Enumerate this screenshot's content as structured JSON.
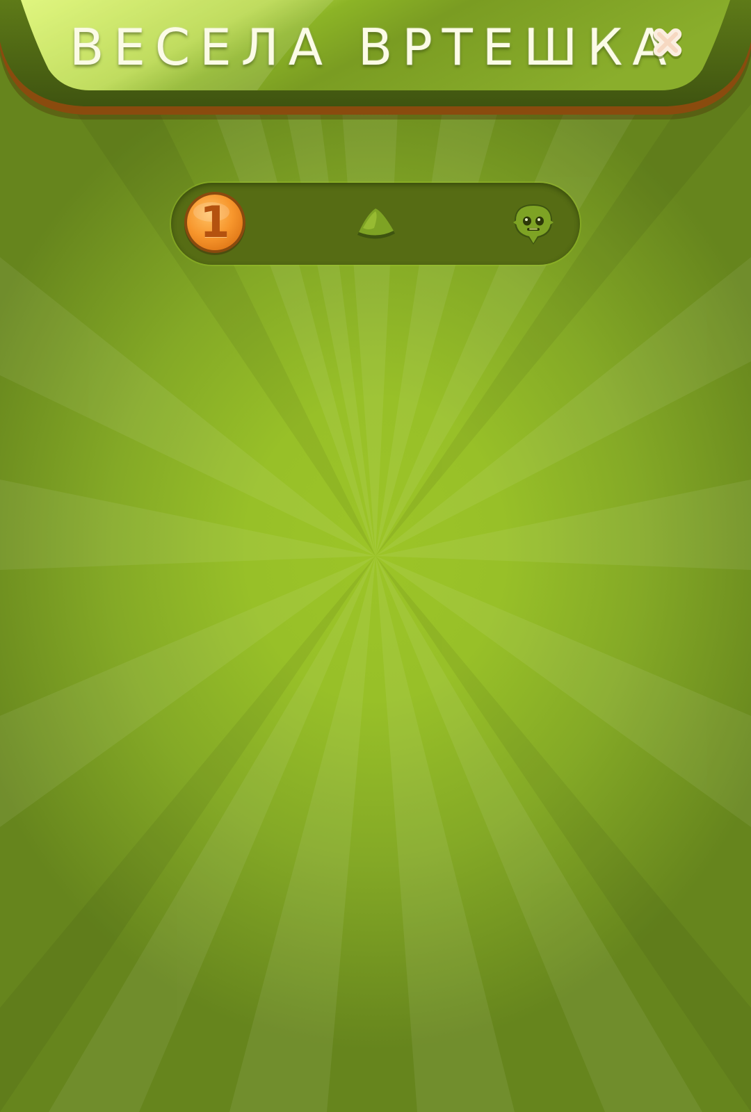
{
  "header": {
    "title": "ВЕСЕЛА ВРТЕШКА",
    "close_icon": "close-x-icon"
  },
  "progress": {
    "current_level": "1",
    "current_level_icon": "orange-coin-level-badge",
    "middle_icon": "green-wedge-piece-icon",
    "goal_icon": "green-monster-icon"
  },
  "colors": {
    "background": "#98c028",
    "header_light": "#d8f46a",
    "header_dark": "#6f8f1e",
    "header_rim": "#7a3f0c",
    "track": "#566c14",
    "badge_orange": "#f59a2e",
    "badge_text": "#b4520f",
    "title_text": "#fbfbe6"
  }
}
